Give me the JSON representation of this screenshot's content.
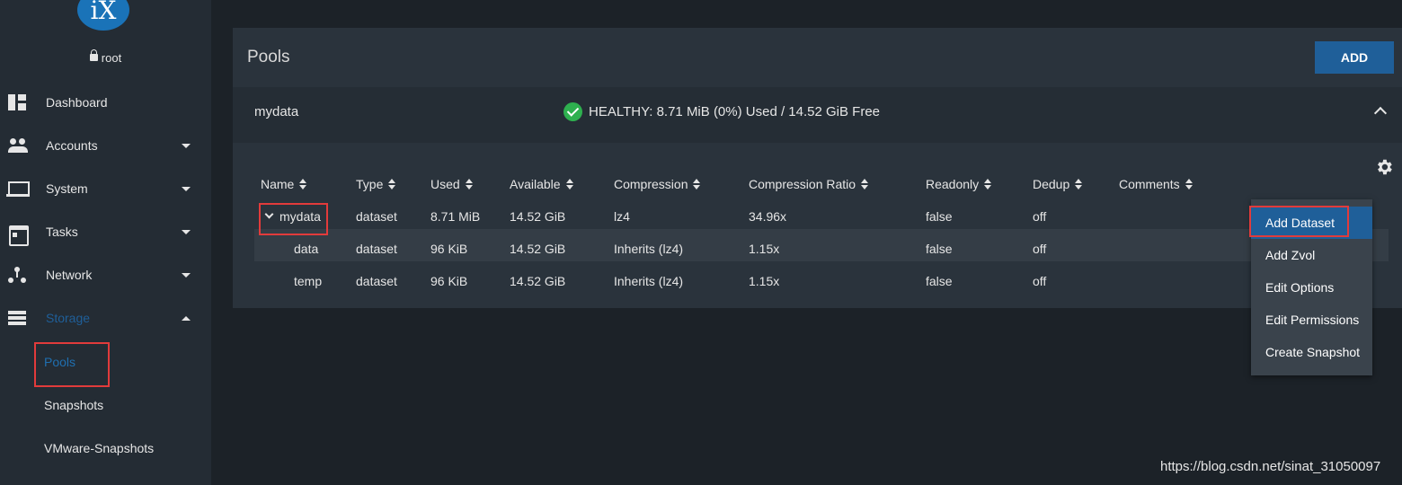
{
  "sidebar": {
    "logo": "iX",
    "user": "root",
    "items": [
      {
        "label": "Dashboard"
      },
      {
        "label": "Accounts"
      },
      {
        "label": "System"
      },
      {
        "label": "Tasks"
      },
      {
        "label": "Network"
      },
      {
        "label": "Storage"
      }
    ],
    "storage_sub": [
      {
        "label": "Pools"
      },
      {
        "label": "Snapshots"
      },
      {
        "label": "VMware-Snapshots"
      }
    ]
  },
  "panel": {
    "title": "Pools",
    "add_label": "ADD"
  },
  "pool": {
    "name": "mydata",
    "status": "HEALTHY: 8.71 MiB (0%) Used / 14.52 GiB Free"
  },
  "table": {
    "headers": [
      "Name",
      "Type",
      "Used",
      "Available",
      "Compression",
      "Compression Ratio",
      "Readonly",
      "Dedup",
      "Comments"
    ],
    "rows": [
      {
        "name": "mydata",
        "type": "dataset",
        "used": "8.71 MiB",
        "available": "14.52 GiB",
        "compression": "lz4",
        "ratio": "34.96x",
        "readonly": "false",
        "dedup": "off"
      },
      {
        "name": "data",
        "type": "dataset",
        "used": "96 KiB",
        "available": "14.52 GiB",
        "compression": "Inherits (lz4)",
        "ratio": "1.15x",
        "readonly": "false",
        "dedup": "off"
      },
      {
        "name": "temp",
        "type": "dataset",
        "used": "96 KiB",
        "available": "14.52 GiB",
        "compression": "Inherits (lz4)",
        "ratio": "1.15x",
        "readonly": "false",
        "dedup": "off"
      }
    ]
  },
  "menu": {
    "items": [
      "Add Dataset",
      "Add Zvol",
      "Edit Options",
      "Edit Permissions",
      "Create Snapshot"
    ]
  },
  "watermark": "https://blog.csdn.net/sinat_31050097",
  "colors": {
    "accent": "#1f5f99",
    "healthy": "#2eb04f",
    "highlight_box": "#e23b3b"
  }
}
